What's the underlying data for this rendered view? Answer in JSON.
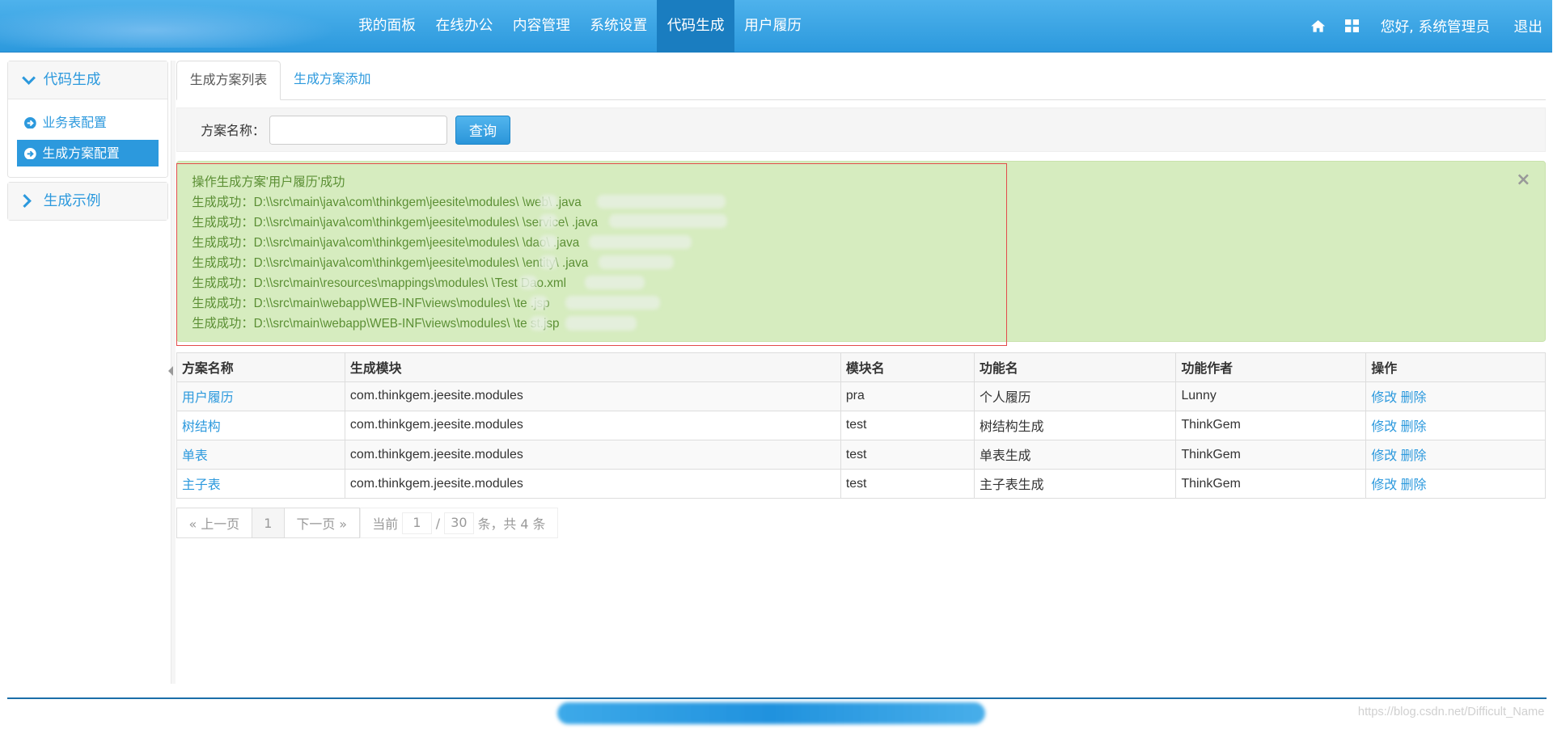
{
  "navbar": {
    "menu": [
      "我的面板",
      "在线办公",
      "内容管理",
      "系统设置",
      "代码生成",
      "用户履历"
    ],
    "active_index": 4,
    "user_greeting": "您好, 系统管理员",
    "logout": "退出",
    "icons": [
      "home-icon",
      "grid-icon"
    ]
  },
  "sidebar": {
    "groups": [
      {
        "title": "代码生成",
        "expanded": true,
        "items": [
          {
            "label": "业务表配置",
            "active": false
          },
          {
            "label": "生成方案配置",
            "active": true
          }
        ]
      },
      {
        "title": "生成示例",
        "expanded": false
      }
    ]
  },
  "tabs": [
    {
      "label": "生成方案列表",
      "active": true
    },
    {
      "label": "生成方案添加",
      "active": false
    }
  ],
  "search": {
    "label": "方案名称：",
    "value": "",
    "button": "查询"
  },
  "alert": {
    "lines": [
      "操作生成方案'用户履历'成功",
      "生成成功：D:\\\\src\\main\\java\\com\\thinkgem\\jeesite\\modules\\   \\web\\                         .java",
      "生成成功：D:\\\\src\\main\\java\\com\\thinkgem\\jeesite\\modules\\   \\service\\                         .java",
      "生成成功：D:\\\\src\\main\\java\\com\\thinkgem\\jeesite\\modules\\   \\dao\\                    .java",
      "生成成功：D:\\\\src\\main\\java\\com\\thinkgem\\jeesite\\modules\\   \\entity\\              .java",
      "生成成功：D:\\\\src\\main\\resources\\mappings\\modules\\   \\Test          Dao.xml",
      "生成成功：D:\\\\src\\main\\webapp\\WEB-INF\\views\\modules\\   \\te                  .jsp",
      "生成成功：D:\\\\src\\main\\webapp\\WEB-INF\\views\\modules\\   \\te                st.jsp"
    ],
    "close": "×",
    "color": "#d6ecbf"
  },
  "table": {
    "headers": [
      "方案名称",
      "生成模块",
      "模块名",
      "功能名",
      "功能作者",
      "操作"
    ],
    "rows": [
      {
        "name": "用户履历",
        "package": "com.thinkgem.jeesite.modules",
        "module": "pra",
        "function": "个人履历",
        "author": "Lunny",
        "edit": "修改",
        "delete": "删除"
      },
      {
        "name": "树结构",
        "package": "com.thinkgem.jeesite.modules",
        "module": "test",
        "function": "树结构生成",
        "author": "ThinkGem",
        "edit": "修改",
        "delete": "删除"
      },
      {
        "name": "单表",
        "package": "com.thinkgem.jeesite.modules",
        "module": "test",
        "function": "单表生成",
        "author": "ThinkGem",
        "edit": "修改",
        "delete": "删除"
      },
      {
        "name": "主子表",
        "package": "com.thinkgem.jeesite.modules",
        "module": "test",
        "function": "主子表生成",
        "author": "ThinkGem",
        "edit": "修改",
        "delete": "删除"
      }
    ]
  },
  "pager": {
    "prev": "« 上一页",
    "page": "1",
    "next": "下一页 »",
    "current_label": "当前",
    "current_page": "1",
    "separator": "/",
    "page_size": "30",
    "total_text": "条，共 4 条"
  },
  "watermark": "https://blog.csdn.net/Difficult_Name",
  "colors": {
    "brand": "#2c99dd",
    "nav_active": "#1a7dc0",
    "alert_bg": "#d6ecbf",
    "alert_text": "#5b8f34",
    "highlight_border": "#e34b4b"
  }
}
